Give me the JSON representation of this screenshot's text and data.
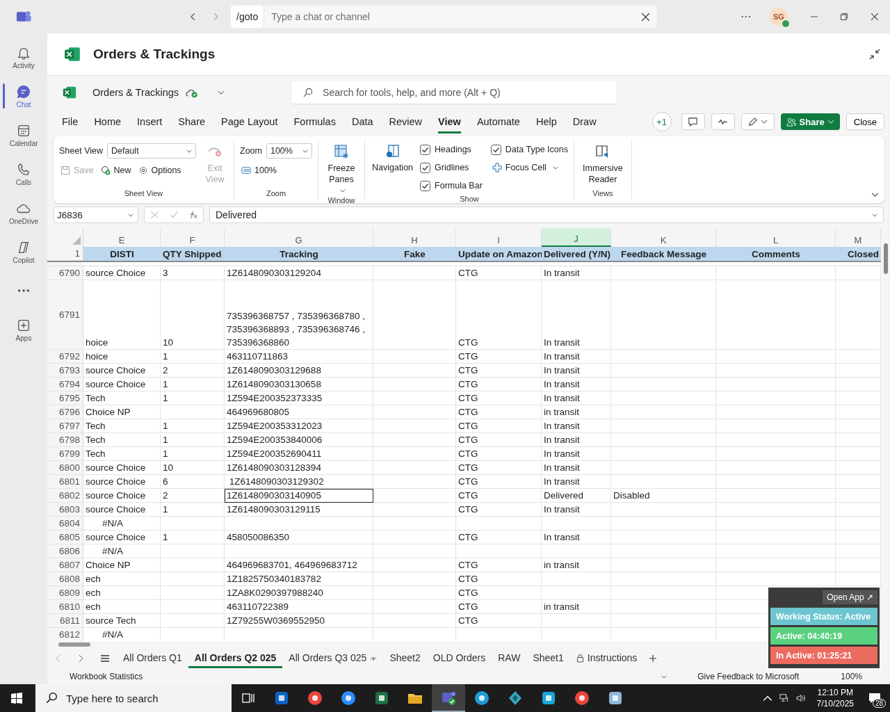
{
  "teams_bar": {
    "command": "/goto",
    "search_placeholder": "Type a chat or channel",
    "avatar_initials": "SG"
  },
  "rail": [
    {
      "kind": "bell",
      "label": "Activity",
      "selected": false
    },
    {
      "kind": "chat",
      "label": "Chat",
      "selected": true
    },
    {
      "kind": "calendar",
      "label": "Calendar",
      "selected": false
    },
    {
      "kind": "phone",
      "label": "Calls",
      "selected": false
    },
    {
      "kind": "cloud",
      "label": "OneDrive",
      "selected": false
    },
    {
      "kind": "copilot",
      "label": "Copilot",
      "selected": false
    },
    {
      "kind": "more",
      "selected": false
    },
    {
      "kind": "plus",
      "label": "Apps",
      "selected": false
    }
  ],
  "app_header": {
    "title": "Orders & Trackings"
  },
  "workbook": {
    "name": "Orders & Trackings",
    "search_placeholder": "Search for tools, help, and more (Alt + Q)"
  },
  "menu": [
    {
      "label": "File",
      "selected": false
    },
    {
      "label": "Home",
      "selected": false
    },
    {
      "label": "Insert",
      "selected": false
    },
    {
      "label": "Share",
      "selected": false
    },
    {
      "label": "Page Layout",
      "selected": false
    },
    {
      "label": "Formulas",
      "selected": false
    },
    {
      "label": "Data",
      "selected": false
    },
    {
      "label": "Review",
      "selected": false
    },
    {
      "label": "View",
      "selected": true
    },
    {
      "label": "Automate",
      "selected": false
    },
    {
      "label": "Help",
      "selected": false
    },
    {
      "label": "Draw",
      "selected": false
    }
  ],
  "toolbar": {
    "presence": "+1",
    "share": "Share",
    "close": "Close"
  },
  "ribbon": {
    "sheet_view": {
      "label": "Sheet View",
      "value": "Default",
      "save": "Save",
      "save_disabled": true,
      "new": "New",
      "options": "Options",
      "exit": "Exit View",
      "exit_disabled": true,
      "group": "Sheet View"
    },
    "zoom": {
      "label": "Zoom",
      "value": "100%",
      "reset": "100%",
      "group": "Zoom"
    },
    "window": {
      "freeze": "Freeze Panes",
      "group": "Window"
    },
    "show": {
      "navigation": "Navigation",
      "checks": [
        {
          "label": "Headings",
          "checked": true
        },
        {
          "label": "Gridlines",
          "checked": true
        },
        {
          "label": "Formula Bar",
          "checked": true
        },
        {
          "label": "Data Type Icons",
          "checked": true
        }
      ],
      "focus_cell": "Focus Cell",
      "group": "Show"
    },
    "views": {
      "reader": "Immersive Reader",
      "group": "Views"
    }
  },
  "formula_bar": {
    "name_box": "J6836",
    "value": "Delivered"
  },
  "grid": {
    "header_row": "1",
    "columns": [
      {
        "letter": "E",
        "header": "DISTI",
        "selected": false
      },
      {
        "letter": "F",
        "header": "QTY Shipped",
        "selected": false
      },
      {
        "letter": "G",
        "header": "Tracking",
        "selected": false
      },
      {
        "letter": "H",
        "header": "Fake",
        "selected": false
      },
      {
        "letter": "I",
        "header": "Update on Amazon",
        "selected": false
      },
      {
        "letter": "J",
        "header": "Delivered (Y/N)",
        "selected": true
      },
      {
        "letter": "K",
        "header": "Feedback Message",
        "selected": false
      },
      {
        "letter": "L",
        "header": "Comments",
        "selected": false
      },
      {
        "letter": "M",
        "header": "Closed",
        "selected": false
      }
    ],
    "rows": [
      {
        "num": "6790",
        "disti": "source Choice",
        "qty": "3",
        "tracking": "1Z6148090303129204",
        "amazon": "CTG",
        "delivered": "In transit",
        "tall": false,
        "outlined": false
      },
      {
        "num": "6791",
        "disti": "hoice",
        "qty": "10",
        "tracking": "735396368757 , 735396368780 ,\n735396368893 , 735396368746 ,\n735396368860",
        "amazon": "CTG",
        "delivered": "In transit",
        "tall": true,
        "outlined": false
      },
      {
        "num": "6792",
        "disti": "hoice",
        "qty": "1",
        "tracking": "463110711863",
        "amazon": "CTG",
        "delivered": "In transit",
        "tall": false,
        "outlined": false
      },
      {
        "num": "6793",
        "disti": "source Choice",
        "qty": "2",
        "tracking": "1Z6148090303129688",
        "amazon": "CTG",
        "delivered": "In transit",
        "tall": false,
        "outlined": false
      },
      {
        "num": "6794",
        "disti": "source Choice",
        "qty": "1",
        "tracking": "1Z6148090303130658",
        "amazon": "CTG",
        "delivered": "In transit",
        "tall": false,
        "outlined": false
      },
      {
        "num": "6795",
        "disti": "Tech",
        "qty": "1",
        "tracking": "1Z594E200352373335",
        "amazon": "CTG",
        "delivered": "In transit",
        "tall": false,
        "outlined": false
      },
      {
        "num": "6796",
        "disti": "Choice NP",
        "tracking": "464969680805",
        "amazon": "CTG",
        "delivered": "in transit",
        "tall": false,
        "outlined": false
      },
      {
        "num": "6797",
        "disti": "Tech",
        "qty": "1",
        "tracking": "1Z594E200353312023",
        "amazon": "CTG",
        "delivered": "In transit",
        "tall": false,
        "outlined": false
      },
      {
        "num": "6798",
        "disti": "Tech",
        "qty": "1",
        "tracking": "1Z594E200353840006",
        "amazon": "CTG",
        "delivered": "In transit",
        "tall": false,
        "outlined": false
      },
      {
        "num": "6799",
        "disti": "Tech",
        "qty": "1",
        "tracking": "1Z594E200352690411",
        "amazon": "CTG",
        "delivered": "In transit",
        "tall": false,
        "outlined": false
      },
      {
        "num": "6800",
        "disti": "source Choice",
        "qty": "10",
        "tracking": "1Z6148090303128394",
        "amazon": "CTG",
        "delivered": "In transit",
        "tall": false,
        "outlined": false
      },
      {
        "num": "6801",
        "disti": "source Choice",
        "qty": "6",
        "tracking": " 1Z6148090303129302",
        "amazon": "CTG",
        "delivered": "In transit",
        "tall": false,
        "outlined": false
      },
      {
        "num": "6802",
        "disti": "source Choice",
        "qty": "2",
        "tracking": "1Z6148090303140905",
        "amazon": "CTG",
        "delivered": "Delivered",
        "feedback": "Disabled",
        "tall": false,
        "outlined": true
      },
      {
        "num": "6803",
        "disti": "source Choice",
        "qty": "1",
        "tracking": "1Z6148090303129115",
        "amazon": "CTG",
        "delivered": "In transit",
        "tall": false,
        "outlined": false
      },
      {
        "num": "6804",
        "disti": "#N/A",
        "tall": false,
        "outlined": false
      },
      {
        "num": "6805",
        "disti": "source Choice",
        "qty": "1",
        "tracking": "458050086350",
        "amazon": "CTG",
        "delivered": "In transit",
        "tall": false,
        "outlined": false
      },
      {
        "num": "6806",
        "disti": "#N/A",
        "tall": false,
        "outlined": false
      },
      {
        "num": "6807",
        "disti": "Choice NP",
        "tracking": "464969683701, 464969683712",
        "amazon": "CTG",
        "delivered": "in transit",
        "tall": false,
        "outlined": false
      },
      {
        "num": "6808",
        "disti": "ech",
        "tracking": "1Z1825750340183782",
        "amazon": "CTG",
        "tall": false,
        "outlined": false
      },
      {
        "num": "6809",
        "disti": "ech",
        "tracking": "1ZA8K0290397988240",
        "amazon": "CTG",
        "tall": false,
        "outlined": false
      },
      {
        "num": "6810",
        "disti": "ech",
        "tracking": "463110722389",
        "amazon": "CTG",
        "delivered": "in transit",
        "tall": false,
        "outlined": false
      },
      {
        "num": "6811",
        "disti": "source Tech",
        "tracking": "1Z79255W0369552950",
        "amazon": "CTG",
        "tall": false,
        "outlined": false
      },
      {
        "num": "6812",
        "disti": "#N/A",
        "tall": false,
        "outlined": false
      }
    ]
  },
  "sheets": [
    {
      "label": "All Orders Q1",
      "kind": "plain",
      "selected": false
    },
    {
      "label": "All Orders Q2 025",
      "kind": "plain",
      "selected": true
    },
    {
      "label": "All Orders Q3 025",
      "kind": "watched",
      "selected": false
    },
    {
      "label": "Sheet2",
      "kind": "plain",
      "selected": false
    },
    {
      "label": "OLD Orders",
      "kind": "plain",
      "selected": false
    },
    {
      "label": "RAW",
      "kind": "plain",
      "selected": false
    },
    {
      "label": "Sheet1",
      "kind": "plain",
      "selected": false
    },
    {
      "label": "Instructions",
      "kind": "locked",
      "selected": false
    }
  ],
  "status_bar": {
    "left": "Workbook Statistics",
    "feedback": "Give Feedback to Microsoft",
    "zoom": "100%"
  },
  "tracker": {
    "open": "Open App ↗",
    "statuses": [
      {
        "text": "Working Status: Active",
        "color": "#6cc5cf"
      },
      {
        "text": "Active: 04:40:19",
        "color": "#5ad17f"
      },
      {
        "text": "In Active: 01:25:21",
        "color": "#ec6b61"
      }
    ]
  },
  "taskbar": {
    "search_placeholder": "Type here to search",
    "apps": [
      {
        "kind": "taskview",
        "selected": false
      },
      {
        "kind": "mail",
        "selected": false
      },
      {
        "kind": "chrome",
        "selected": false
      },
      {
        "kind": "zoom",
        "selected": false
      },
      {
        "kind": "excel",
        "selected": false
      },
      {
        "kind": "folder",
        "selected": false
      },
      {
        "kind": "teams",
        "selected": true
      },
      {
        "kind": "edge",
        "selected": false
      },
      {
        "kind": "diamond",
        "selected": false
      },
      {
        "kind": "script",
        "selected": false
      },
      {
        "kind": "chrome",
        "selected": false
      },
      {
        "kind": "notes",
        "selected": false
      }
    ],
    "time": "12:10 PM",
    "date": "7/10/2025",
    "notifications": "28"
  }
}
